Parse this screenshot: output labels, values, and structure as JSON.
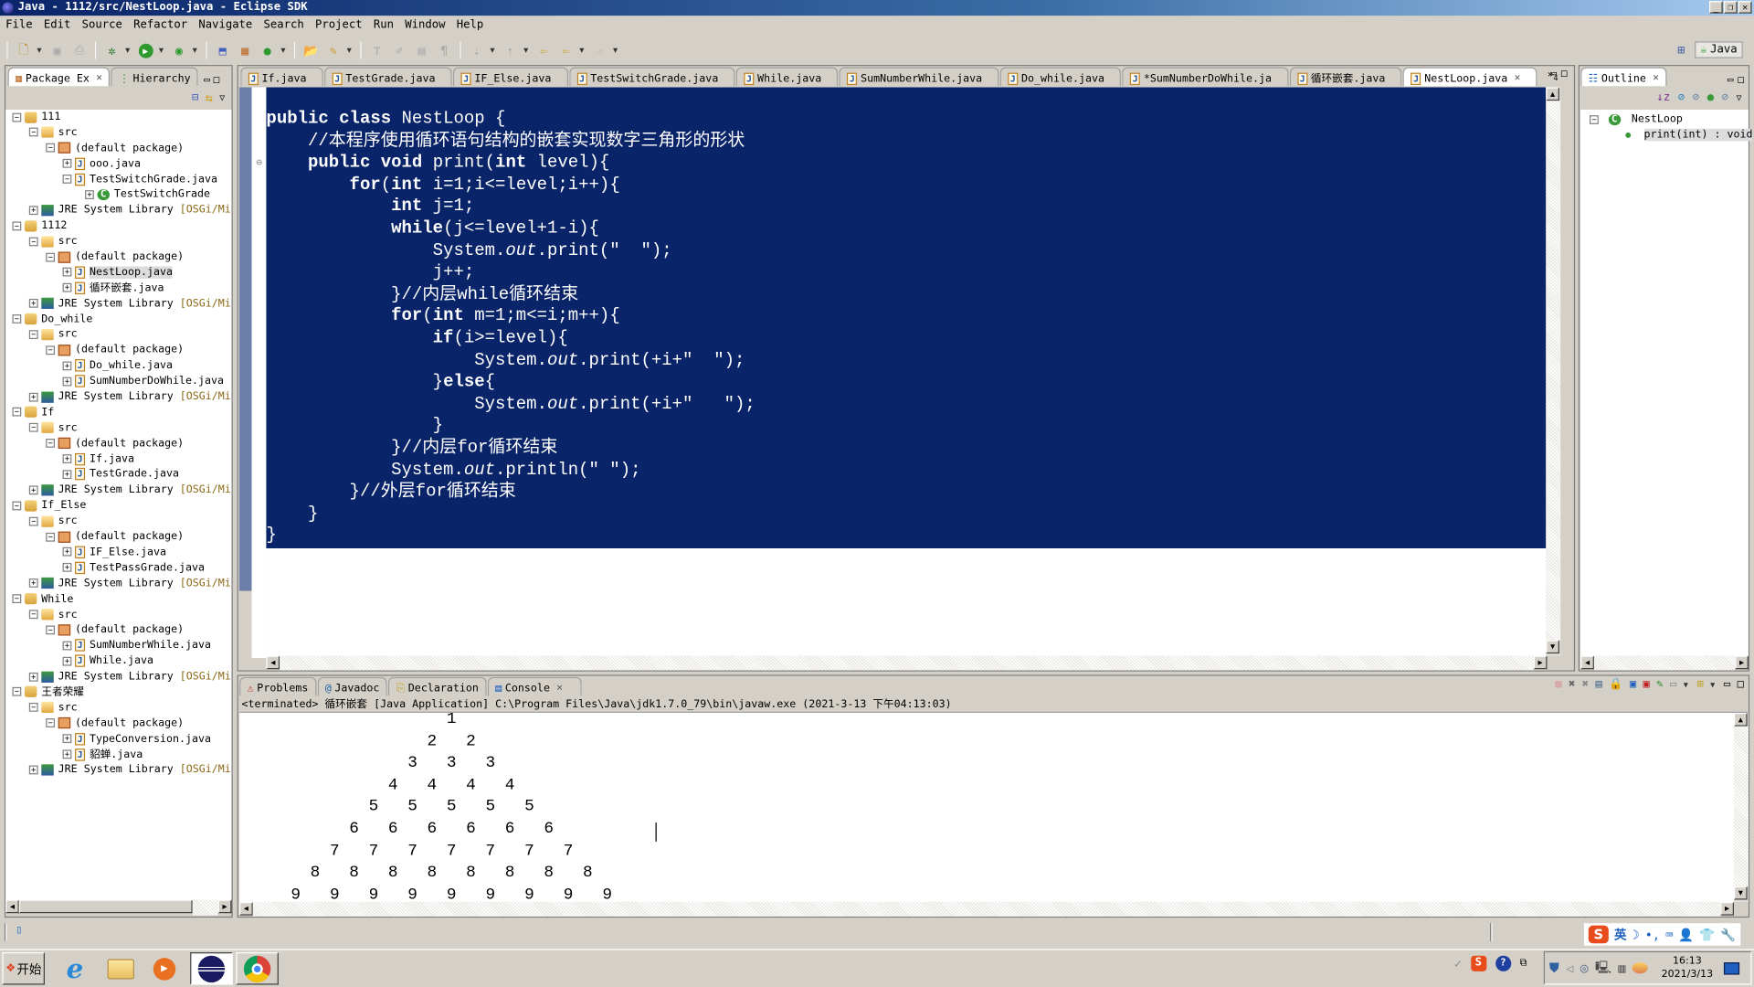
{
  "window": {
    "title": "Java - 1112/src/NestLoop.java - Eclipse SDK",
    "controls": [
      "minimize",
      "restore",
      "close"
    ]
  },
  "menubar": [
    "File",
    "Edit",
    "Source",
    "Refactor",
    "Navigate",
    "Search",
    "Project",
    "Run",
    "Window",
    "Help"
  ],
  "perspective": {
    "label": "Java"
  },
  "left_panel": {
    "tabs": [
      {
        "label": "Package Ex",
        "active": true,
        "closable": true
      },
      {
        "label": "Hierarchy",
        "active": false
      }
    ],
    "tree": [
      {
        "level": 0,
        "type": "project",
        "label": "111",
        "expanded": true
      },
      {
        "level": 1,
        "type": "src",
        "label": "src",
        "expanded": true
      },
      {
        "level": 2,
        "type": "package",
        "label": "(default package)",
        "expanded": true
      },
      {
        "level": 3,
        "type": "java",
        "label": "ooo.java",
        "expanded": false
      },
      {
        "level": 3,
        "type": "java",
        "label": "TestSwitchGrade.java",
        "expanded": true
      },
      {
        "level": 4,
        "type": "class",
        "label": "TestSwitchGrade",
        "expanded": false
      },
      {
        "level": 1,
        "type": "jre",
        "label": "JRE System Library",
        "suffix": "[OSGi/Minimu",
        "expanded": false
      },
      {
        "level": 0,
        "type": "project",
        "label": "1112",
        "expanded": true
      },
      {
        "level": 1,
        "type": "src",
        "label": "src",
        "expanded": true
      },
      {
        "level": 2,
        "type": "package",
        "label": "(default package)",
        "expanded": true
      },
      {
        "level": 3,
        "type": "java",
        "label": "NestLoop.java",
        "expanded": false,
        "selected": true
      },
      {
        "level": 3,
        "type": "java",
        "label": "循环嵌套.java",
        "expanded": false
      },
      {
        "level": 1,
        "type": "jre",
        "label": "JRE System Library",
        "suffix": "[OSGi/Minimu",
        "expanded": false
      },
      {
        "level": 0,
        "type": "project",
        "label": "Do_while",
        "expanded": true
      },
      {
        "level": 1,
        "type": "src",
        "label": "src",
        "expanded": true
      },
      {
        "level": 2,
        "type": "package",
        "label": "(default package)",
        "expanded": true
      },
      {
        "level": 3,
        "type": "java",
        "label": "Do_while.java",
        "expanded": false
      },
      {
        "level": 3,
        "type": "java",
        "label": "SumNumberDoWhile.java",
        "expanded": false
      },
      {
        "level": 1,
        "type": "jre",
        "label": "JRE System Library",
        "suffix": "[OSGi/Minimu",
        "expanded": false
      },
      {
        "level": 0,
        "type": "project",
        "label": "If",
        "expanded": true
      },
      {
        "level": 1,
        "type": "src",
        "label": "src",
        "expanded": true
      },
      {
        "level": 2,
        "type": "package",
        "label": "(default package)",
        "expanded": true
      },
      {
        "level": 3,
        "type": "java",
        "label": "If.java",
        "expanded": false
      },
      {
        "level": 3,
        "type": "java",
        "label": "TestGrade.java",
        "expanded": false
      },
      {
        "level": 1,
        "type": "jre",
        "label": "JRE System Library",
        "suffix": "[OSGi/Minimu",
        "expanded": false
      },
      {
        "level": 0,
        "type": "project",
        "label": "If_Else",
        "expanded": true
      },
      {
        "level": 1,
        "type": "src",
        "label": "src",
        "expanded": true
      },
      {
        "level": 2,
        "type": "package",
        "label": "(default package)",
        "expanded": true
      },
      {
        "level": 3,
        "type": "java",
        "label": "IF_Else.java",
        "expanded": false
      },
      {
        "level": 3,
        "type": "java",
        "label": "TestPassGrade.java",
        "expanded": false
      },
      {
        "level": 1,
        "type": "jre",
        "label": "JRE System Library",
        "suffix": "[OSGi/Minimu",
        "expanded": false
      },
      {
        "level": 0,
        "type": "project",
        "label": "While",
        "expanded": true
      },
      {
        "level": 1,
        "type": "src",
        "label": "src",
        "expanded": true
      },
      {
        "level": 2,
        "type": "package",
        "label": "(default package)",
        "expanded": true
      },
      {
        "level": 3,
        "type": "java",
        "label": "SumNumberWhile.java",
        "expanded": false
      },
      {
        "level": 3,
        "type": "java",
        "label": "While.java",
        "expanded": false
      },
      {
        "level": 1,
        "type": "jre",
        "label": "JRE System Library",
        "suffix": "[OSGi/Minimu",
        "expanded": false
      },
      {
        "level": 0,
        "type": "project",
        "label": "王者荣耀",
        "expanded": true
      },
      {
        "level": 1,
        "type": "src",
        "label": "src",
        "expanded": true
      },
      {
        "level": 2,
        "type": "package",
        "label": "(default package)",
        "expanded": true
      },
      {
        "level": 3,
        "type": "java",
        "label": "TypeConversion.java",
        "expanded": false
      },
      {
        "level": 3,
        "type": "java",
        "label": "貂蝉.java",
        "expanded": false
      },
      {
        "level": 1,
        "type": "jre",
        "label": "JRE System Library",
        "suffix": "[OSGi/Minimu",
        "expanded": false
      }
    ]
  },
  "editor": {
    "tabs": [
      {
        "label": "If.java"
      },
      {
        "label": "TestGrade.java"
      },
      {
        "label": "IF_Else.java"
      },
      {
        "label": "TestSwitchGrade.java"
      },
      {
        "label": "While.java"
      },
      {
        "label": "SumNumberWhile.java"
      },
      {
        "label": "Do_while.java"
      },
      {
        "label": "*SumNumberDoWhile.ja"
      },
      {
        "label": "循环嵌套.java"
      },
      {
        "label": "NestLoop.java",
        "active": true,
        "closable": true
      }
    ],
    "overflow_count": "4",
    "code_lines": [
      [
        {
          "t": "public class",
          "k": 1
        },
        {
          "t": " NestLoop {"
        }
      ],
      [
        {
          "t": "    //本程序使用循环语句结构的嵌套实现数字三角形的形状"
        }
      ],
      [
        {
          "t": "    "
        },
        {
          "t": "public void",
          "k": 1
        },
        {
          "t": " print("
        },
        {
          "t": "int",
          "k": 1
        },
        {
          "t": " level){"
        }
      ],
      [
        {
          "t": "        "
        },
        {
          "t": "for",
          "k": 1
        },
        {
          "t": "("
        },
        {
          "t": "int",
          "k": 1
        },
        {
          "t": " i=1;i<=level;i++){"
        }
      ],
      [
        {
          "t": "            "
        },
        {
          "t": "int",
          "k": 1
        },
        {
          "t": " j=1;"
        }
      ],
      [
        {
          "t": "            "
        },
        {
          "t": "while",
          "k": 1
        },
        {
          "t": "(j<=level+1-i){"
        }
      ],
      [
        {
          "t": "                System."
        },
        {
          "t": "out",
          "i": 1
        },
        {
          "t": ".print(\"  \");"
        }
      ],
      [
        {
          "t": "                j++;"
        }
      ],
      [
        {
          "t": "            }//内层while循环结束"
        }
      ],
      [
        {
          "t": "            "
        },
        {
          "t": "for",
          "k": 1
        },
        {
          "t": "("
        },
        {
          "t": "int",
          "k": 1
        },
        {
          "t": " m=1;m<=i;m++){"
        }
      ],
      [
        {
          "t": "                "
        },
        {
          "t": "if",
          "k": 1
        },
        {
          "t": "(i>=level){"
        }
      ],
      [
        {
          "t": "                    System."
        },
        {
          "t": "out",
          "i": 1
        },
        {
          "t": ".print(+i+\"  \");"
        }
      ],
      [
        {
          "t": "                }"
        },
        {
          "t": "else",
          "k": 1
        },
        {
          "t": "{"
        }
      ],
      [
        {
          "t": "                    System."
        },
        {
          "t": "out",
          "i": 1
        },
        {
          "t": ".print(+i+\"   \");"
        }
      ],
      [
        {
          "t": "                }"
        }
      ],
      [
        {
          "t": "            }//内层for循环结束"
        }
      ],
      [
        {
          "t": "            System."
        },
        {
          "t": "out",
          "i": 1
        },
        {
          "t": ".println(\" \");"
        }
      ],
      [
        {
          "t": "        }//外层for循环结束"
        }
      ],
      [
        {
          "t": "    }"
        }
      ],
      [
        {
          "t": "}"
        }
      ]
    ]
  },
  "outline": {
    "tab": "Outline",
    "items": [
      {
        "label": "NestLoop",
        "type": "class"
      },
      {
        "label": "print(int) : void",
        "type": "method",
        "selected": true
      }
    ]
  },
  "bottom_panel": {
    "tabs": [
      {
        "label": "Problems"
      },
      {
        "label": "Javadoc"
      },
      {
        "label": "Declaration"
      },
      {
        "label": "Console",
        "active": true,
        "closable": true
      }
    ],
    "status_line": "<terminated> 循环嵌套 [Java Application] C:\\Program Files\\Java\\jdk1.7.0_79\\bin\\javaw.exe (2021-3-13 下午04:13:03)",
    "output_lines": [
      "                1",
      "              2   2",
      "            3   3   3",
      "          4   4   4   4",
      "        5   5   5   5   5",
      "      6   6   6   6   6   6",
      "    7   7   7   7   7   7   7",
      "  8   8   8   8   8   8   8   8",
      "9   9   9   9   9   9   9   9   9"
    ]
  },
  "ime": {
    "lang": "英"
  },
  "taskbar": {
    "start_label": "开始",
    "apps": [
      "internet-explorer",
      "file-explorer",
      "media-player",
      "eclipse",
      "chrome"
    ],
    "clock_time": "16:13",
    "clock_date": "2021/3/13"
  }
}
